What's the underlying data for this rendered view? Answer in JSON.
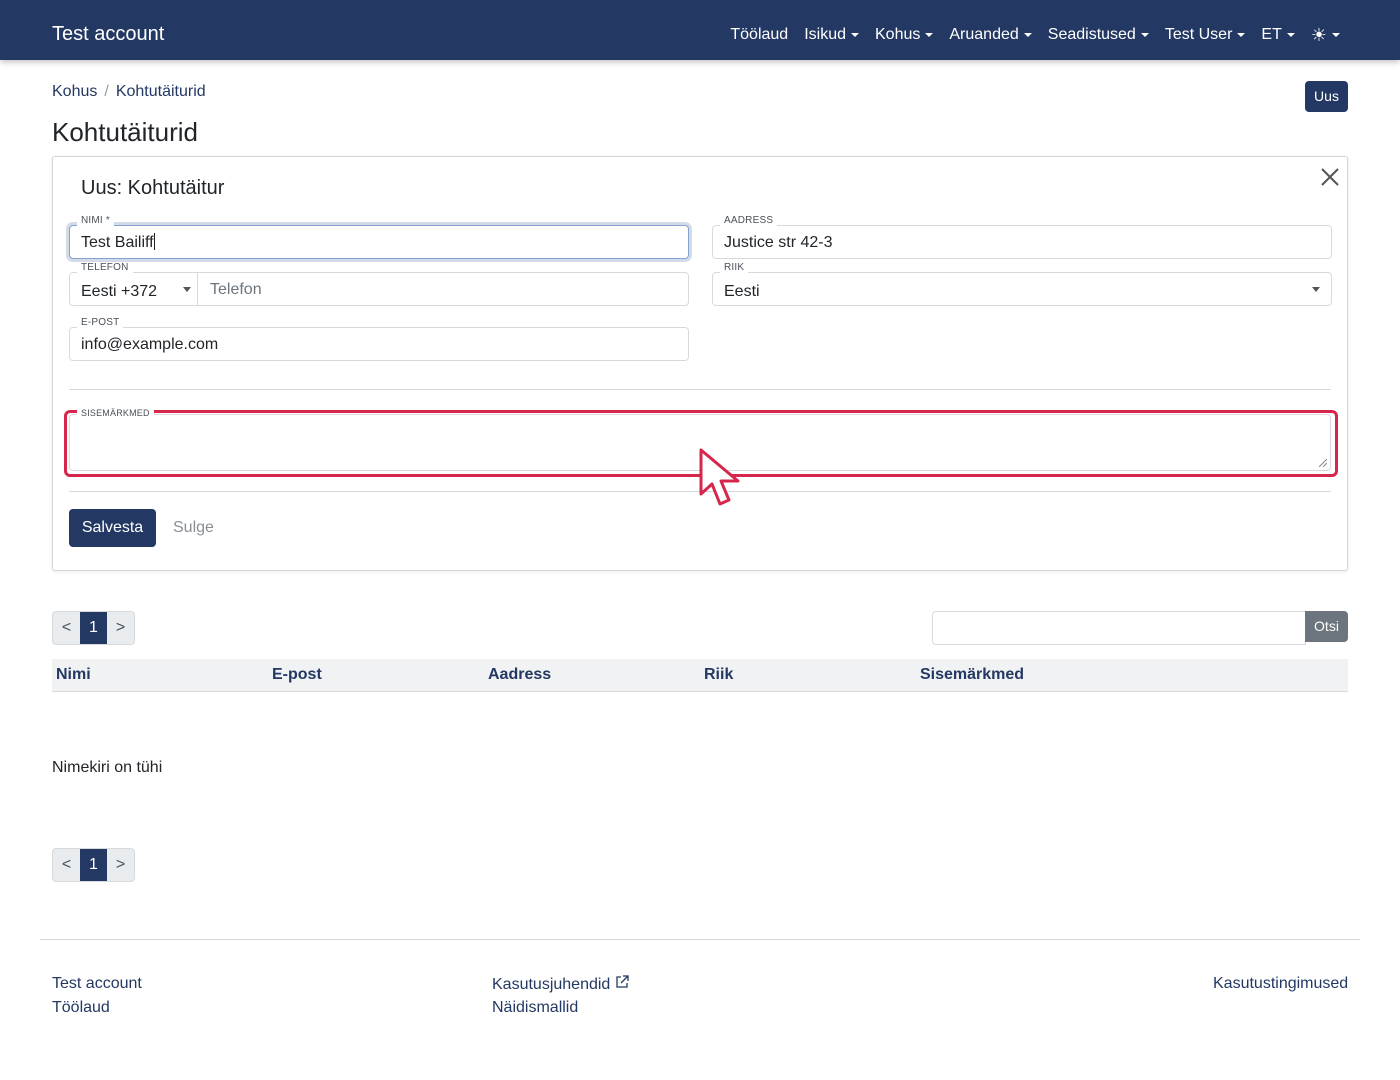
{
  "navbar": {
    "brand": "Test account",
    "items": [
      "Töölaud",
      "Isikud",
      "Kohus",
      "Aruanded",
      "Seadistused",
      "Test User",
      "ET"
    ],
    "theme_icon": "☀"
  },
  "breadcrumb": {
    "items": [
      "Kohus",
      "Kohtutäiturid"
    ],
    "separator": "/"
  },
  "header": {
    "title": "Kohtutäiturid",
    "new_button": "Uus"
  },
  "form": {
    "title": "Uus: Kohtutäitur",
    "name": {
      "label": "NIMI *",
      "value": "Test Bailiff"
    },
    "address": {
      "label": "AADRESS",
      "value": "Justice str 42-3"
    },
    "phone": {
      "label": "TELEFON",
      "country": "Eesti +372",
      "placeholder": "Telefon"
    },
    "country": {
      "label": "RIIK",
      "value": "Eesti"
    },
    "email": {
      "label": "E-POST",
      "value": "info@example.com"
    },
    "notes": {
      "label": "SISEMÄRKMED",
      "value": ""
    },
    "save_label": "Salvesta",
    "close_label": "Sulge"
  },
  "pagination": {
    "prev": "<",
    "current": "1",
    "next": ">"
  },
  "search": {
    "button": "Otsi",
    "value": ""
  },
  "table": {
    "columns": [
      "Nimi",
      "E-post",
      "Aadress",
      "Riik",
      "Sisemärkmed"
    ],
    "empty_text": "Nimekiri on tühi"
  },
  "footer": {
    "left": [
      "Test account",
      "Töölaud"
    ],
    "middle": [
      "Kasutusjuhendid",
      "Näidismallid"
    ],
    "right": "Kasutustingimused"
  },
  "colors": {
    "brand": "#233862",
    "highlight": "#d6264c",
    "secondary": "#6c757d"
  },
  "icons": [
    "sun-icon",
    "close-icon",
    "external-link-icon",
    "chevron-down-icon",
    "mouse-cursor-icon"
  ]
}
